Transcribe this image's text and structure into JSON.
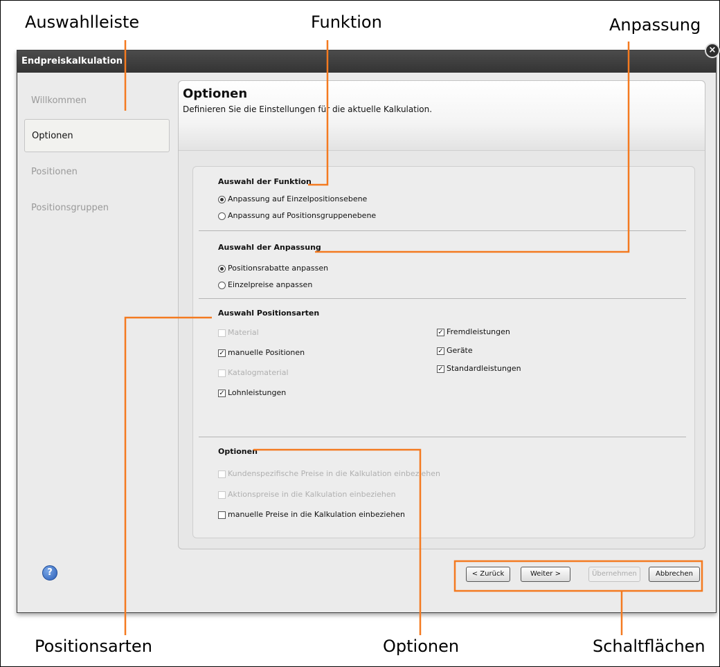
{
  "annotations": {
    "top_left": "Auswahlleiste",
    "top_center": "Funktion",
    "top_right": "Anpassung",
    "bottom_left": "Positionsarten",
    "bottom_center": "Optionen",
    "bottom_right": "Schaltflächen"
  },
  "accent_color": "#f47a20",
  "window": {
    "title": "Endpreiskalkulation",
    "close_icon": "×"
  },
  "sidebar": {
    "items": [
      {
        "label": "Willkommen",
        "state": "disabled"
      },
      {
        "label": "Optionen",
        "state": "active"
      },
      {
        "label": "Positionen",
        "state": "disabled"
      },
      {
        "label": "Positionsgruppen",
        "state": "disabled"
      }
    ]
  },
  "header": {
    "title": "Optionen",
    "subtitle": "Definieren Sie die Einstellungen für die aktuelle Kalkulation."
  },
  "funktion": {
    "title": "Auswahl der Funktion",
    "options": [
      {
        "label": "Anpassung auf Einzelpositionsebene",
        "selected": true
      },
      {
        "label": "Anpassung auf Positionsgruppenebene",
        "selected": false
      }
    ]
  },
  "anpassung": {
    "title": "Auswahl der Anpassung",
    "options": [
      {
        "label": "Positionsrabatte anpassen",
        "selected": true
      },
      {
        "label": "Einzelpreise anpassen",
        "selected": false
      }
    ]
  },
  "positionsarten": {
    "title": "Auswahl Positionsarten",
    "items": [
      {
        "label": "Material",
        "checked": false,
        "disabled": true
      },
      {
        "label": "manuelle Positionen",
        "checked": true,
        "disabled": false
      },
      {
        "label": "Katalogmaterial",
        "checked": false,
        "disabled": true
      },
      {
        "label": "Lohnleistungen",
        "checked": true,
        "disabled": false
      },
      {
        "label": "Fremdleistungen",
        "checked": true,
        "disabled": false
      },
      {
        "label": "Geräte",
        "checked": true,
        "disabled": false
      },
      {
        "label": "Standardleistungen",
        "checked": true,
        "disabled": false
      }
    ]
  },
  "optionen": {
    "title": "Optionen",
    "items": [
      {
        "label": "Kundenspezifische Preise in die Kalkulation einbeziehen",
        "checked": false,
        "disabled": true
      },
      {
        "label": "Aktionspreise in die Kalkulation einbeziehen",
        "checked": false,
        "disabled": true
      },
      {
        "label": "manuelle Preise in die Kalkulation einbeziehen",
        "checked": false,
        "disabled": false
      }
    ]
  },
  "footer": {
    "help_icon": "?",
    "buttons": {
      "back": "< Zurück",
      "next": "Weiter >",
      "apply": "Übernehmen",
      "cancel": "Abbrechen"
    }
  }
}
